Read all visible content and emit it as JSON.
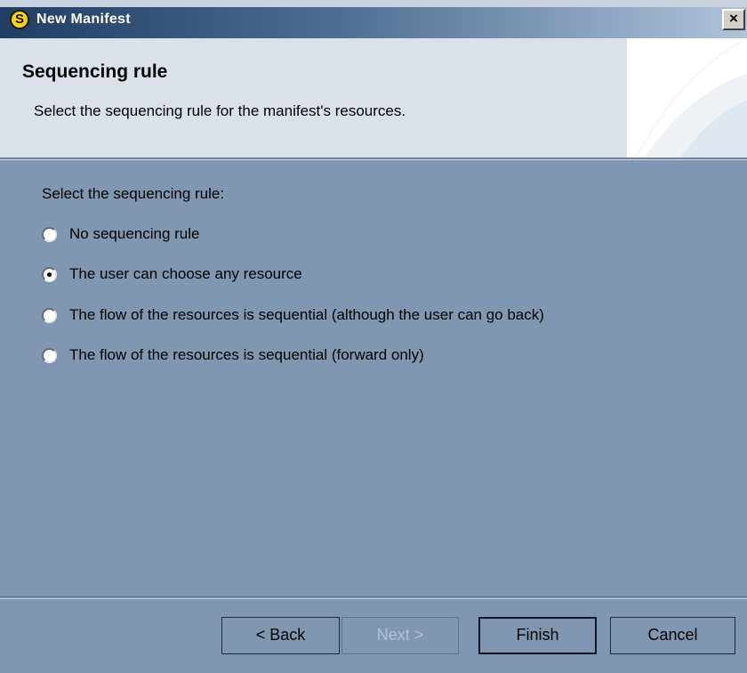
{
  "window": {
    "title": "New Manifest",
    "app_icon_letter": "S",
    "close_label": "×"
  },
  "header": {
    "title": "Sequencing rule",
    "description": "Select the sequencing rule for the manifest's resources."
  },
  "main": {
    "prompt": "Select the sequencing rule:",
    "options": [
      {
        "label": "No sequencing rule",
        "checked": false
      },
      {
        "label": "The user can choose any resource",
        "checked": true
      },
      {
        "label": "The flow of the resources is sequential (although the user can go back)",
        "checked": false
      },
      {
        "label": "The flow of the resources is sequential (forward only)",
        "checked": false
      }
    ]
  },
  "buttons": {
    "back": "< Back",
    "next": "Next >",
    "finish": "Finish",
    "cancel": "Cancel"
  },
  "colors": {
    "dialog_background": "#8097b1",
    "header_background": "#dbe1e8",
    "titlebar_start": "#203d63",
    "titlebar_end": "#aec4da",
    "app_icon": "#ffd200"
  }
}
